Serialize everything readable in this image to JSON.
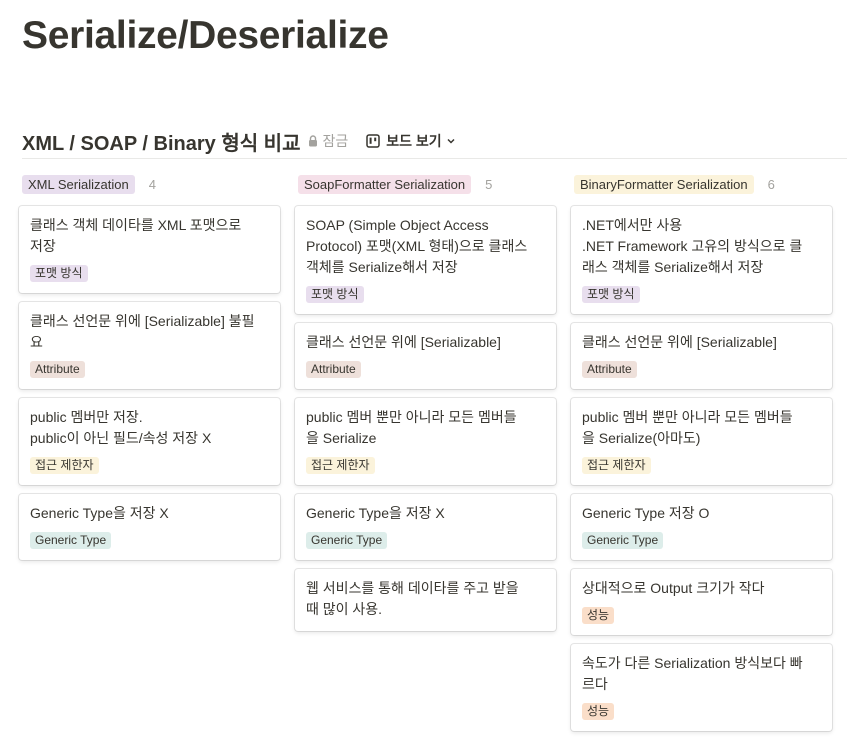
{
  "page": {
    "title": "Serialize/Deserialize"
  },
  "database": {
    "title": "XML / SOAP / Binary 형식 비교",
    "lock_label": "잠금",
    "view_label": "보드 보기"
  },
  "colors": {
    "purple": "#e8deee",
    "pink": "#f5e0e9",
    "yellow": "#fbf3db",
    "brown": "#eee0da",
    "green": "#ddedea",
    "orange": "#fadec9",
    "red": "#ffe2dd"
  },
  "columns": [
    {
      "label": "XML Serialization",
      "count": "4",
      "color": "purple",
      "cards": [
        {
          "text": "클래스 객체 데이타를 XML 포맷으로\n저장",
          "tag": "포맷 방식",
          "tag_color": "purple"
        },
        {
          "text": "클래스 선언문 위에 [Serializable] 불필\n요",
          "tag": "Attribute",
          "tag_color": "brown"
        },
        {
          "text": "public 멤버만 저장.\npublic이 아닌 필드/속성 저장 X",
          "tag": "접근 제한자",
          "tag_color": "yellow"
        },
        {
          "text": "Generic Type을 저장 X",
          "tag": "Generic Type",
          "tag_color": "green"
        }
      ]
    },
    {
      "label": "SoapFormatter Serialization",
      "count": "5",
      "color": "pink",
      "cards": [
        {
          "text": "SOAP (Simple Object Access\nProtocol) 포맷(XML 형태)으로 클래스\n객체를 Serialize해서 저장",
          "tag": "포맷 방식",
          "tag_color": "purple"
        },
        {
          "text": "클래스 선언문 위에 [Serializable]",
          "tag": "Attribute",
          "tag_color": "brown"
        },
        {
          "text": "public 멤버 뿐만 아니라 모든 멤버들\n을 Serialize",
          "tag": "접근 제한자",
          "tag_color": "yellow"
        },
        {
          "text": "Generic Type을 저장 X",
          "tag": "Generic Type",
          "tag_color": "green"
        },
        {
          "text": "웹 서비스를 통해 데이타를 주고 받을\n때 많이 사용.",
          "tag": "",
          "tag_color": ""
        }
      ]
    },
    {
      "label": "BinaryFormatter Serialization",
      "count": "6",
      "color": "yellow",
      "cards": [
        {
          "text": ".NET에서만 사용\n.NET Framework 고유의 방식으로 클\n래스 객체를 Serialize해서 저장",
          "tag": "포맷 방식",
          "tag_color": "purple"
        },
        {
          "text": "클래스 선언문 위에 [Serializable]",
          "tag": "Attribute",
          "tag_color": "brown"
        },
        {
          "text": "public 멤버 뿐만 아니라 모든 멤버들\n을 Serialize(아마도)",
          "tag": "접근 제한자",
          "tag_color": "yellow"
        },
        {
          "text": "Generic Type 저장 O",
          "tag": "Generic Type",
          "tag_color": "green"
        },
        {
          "text": "상대적으로 Output 크기가 작다",
          "tag": "성능",
          "tag_color": "orange"
        },
        {
          "text": "속도가 다른 Serialization 방식보다 빠\n르다",
          "tag": "성능",
          "tag_color": "orange"
        }
      ]
    }
  ]
}
